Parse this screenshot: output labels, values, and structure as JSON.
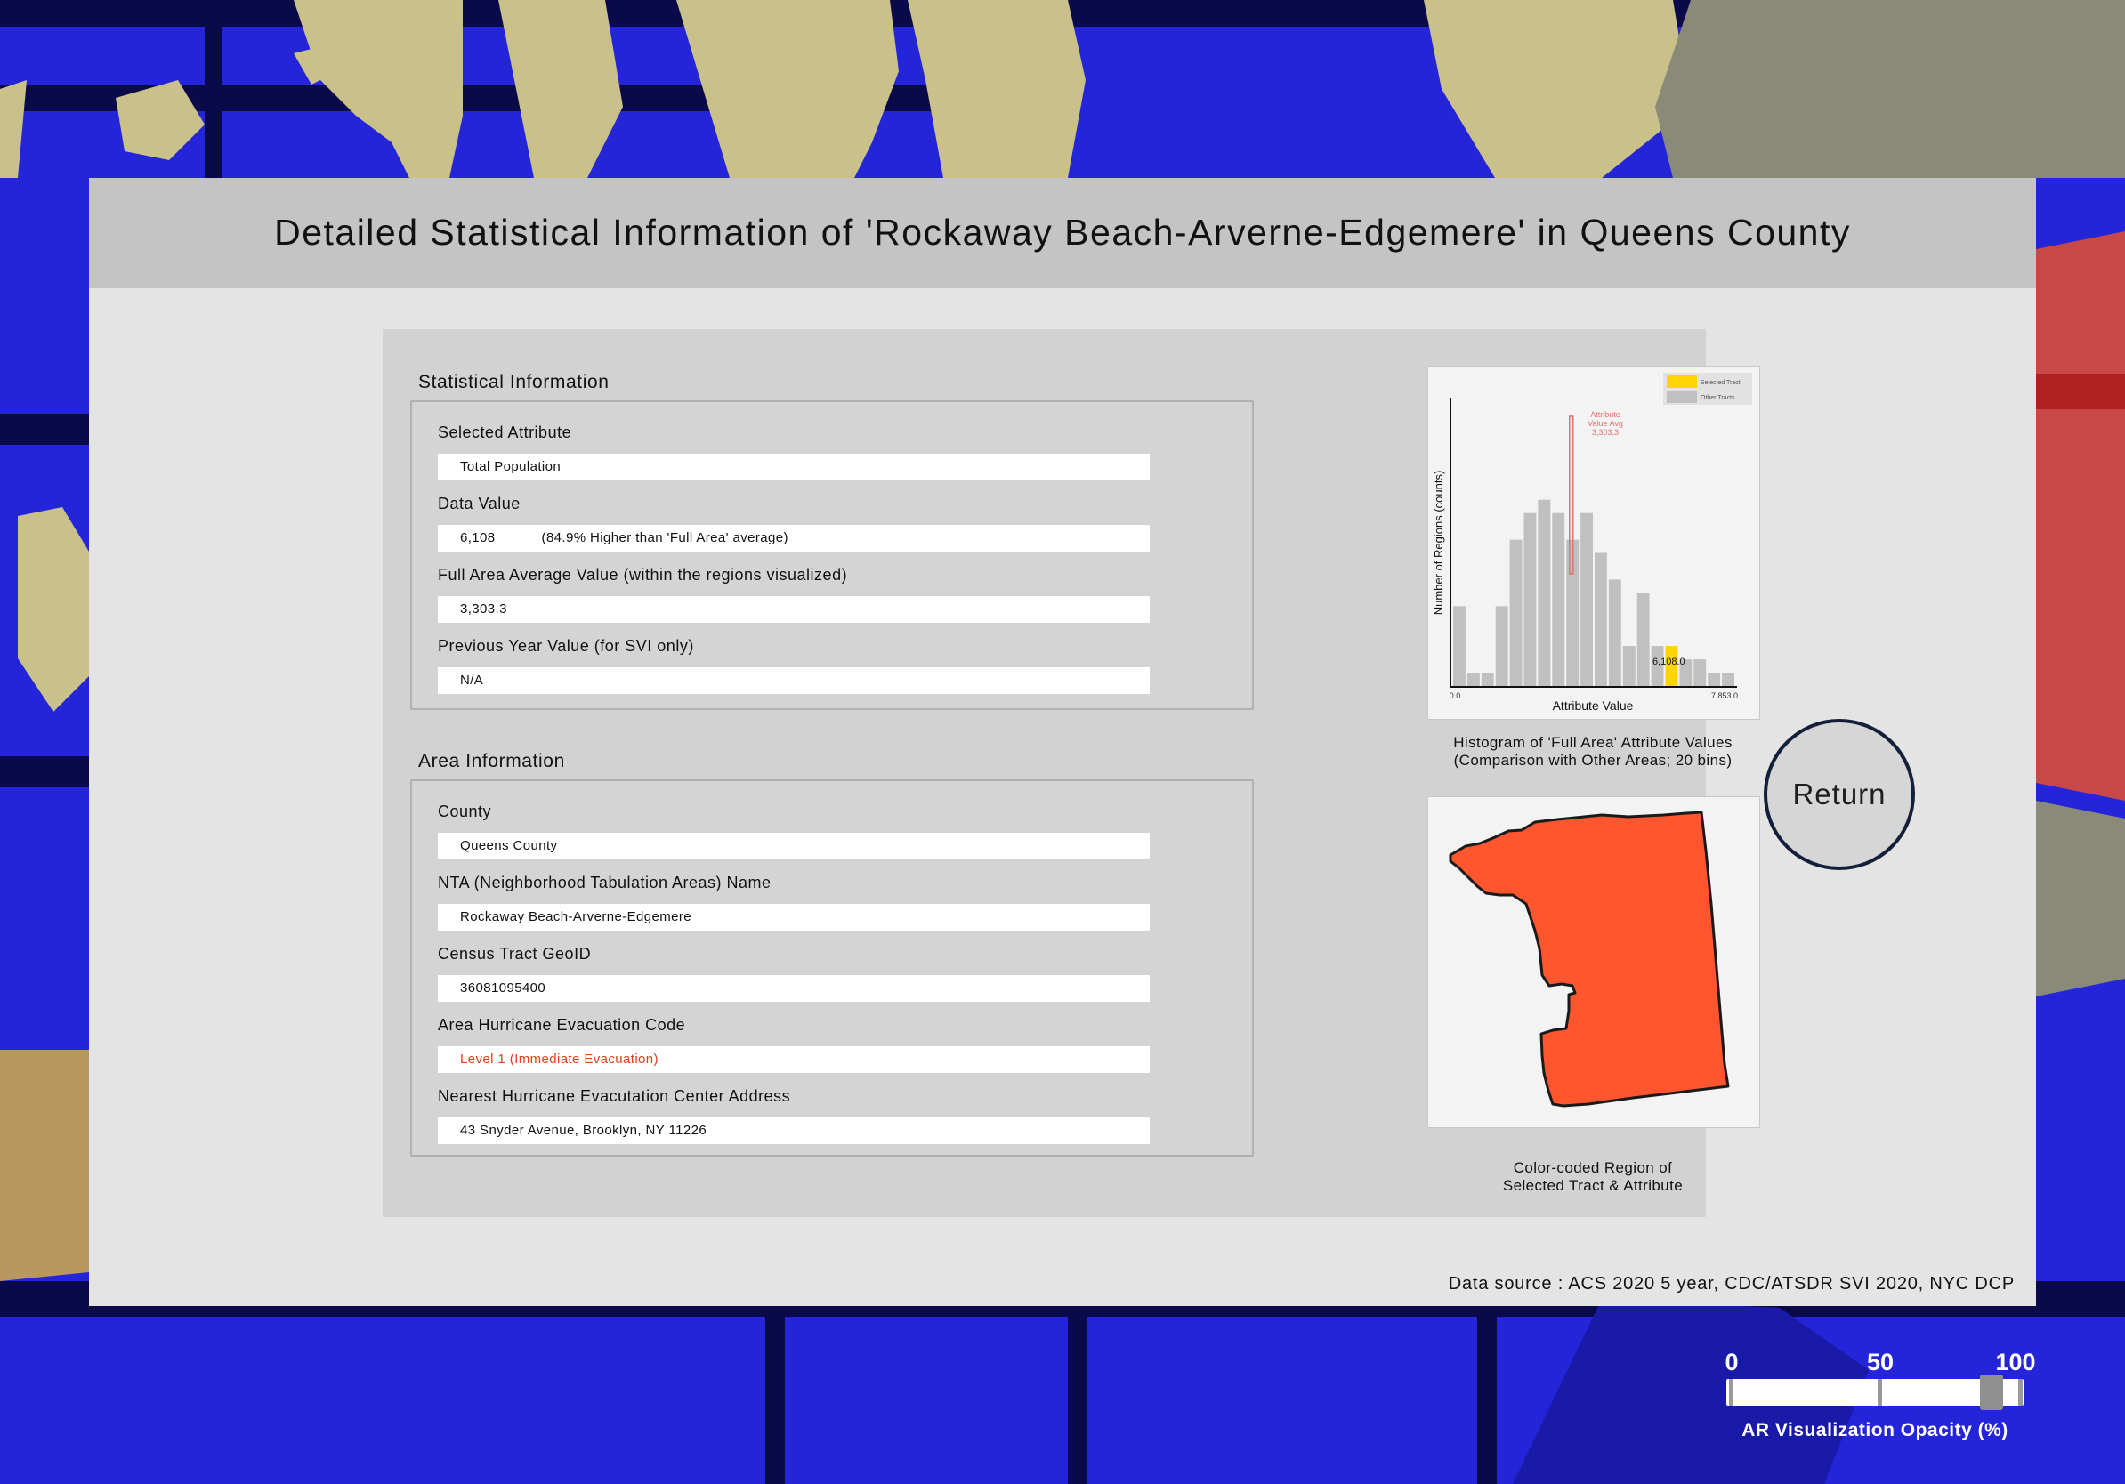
{
  "modal": {
    "title": "Detailed Statistical Information of 'Rockaway Beach-Arverne-Edgemere' in Queens County",
    "data_source": "Data source : ACS 2020 5 year, CDC/ATSDR SVI 2020, NYC DCP"
  },
  "statistical": {
    "section_label": "Statistical Information",
    "selected_attribute_label": "Selected Attribute",
    "selected_attribute_value": "Total Population",
    "data_value_label": "Data Value",
    "data_value": "6,108",
    "data_value_comparison": "(84.9% Higher than 'Full Area' average)",
    "full_area_avg_label": "Full Area Average Value (within the regions visualized)",
    "full_area_avg_value": "3,303.3",
    "previous_year_label": "Previous Year Value (for SVI only)",
    "previous_year_value": "N/A"
  },
  "area": {
    "section_label": "Area Information",
    "county_label": "County",
    "county_value": "Queens County",
    "nta_label": "NTA (Neighborhood Tabulation Areas) Name",
    "nta_value": "Rockaway Beach-Arverne-Edgemere",
    "geoid_label": "Census Tract GeoID",
    "geoid_value": "36081095400",
    "evac_code_label": "Area Hurricane Evacuation Code",
    "evac_code_value": "Level 1 (Immediate Evacuation)",
    "evac_center_label": "Nearest Hurricane Evacutation Center Address",
    "evac_center_value": "43 Snyder Avenue, Brooklyn, NY 11226"
  },
  "histogram": {
    "caption_line1": "Histogram of 'Full Area' Attribute Values",
    "caption_line2": "(Comparison with Other Areas; 20 bins)"
  },
  "region_map": {
    "caption_line1": "Color-coded Region of",
    "caption_line2": "Selected Tract & Attribute",
    "fill_color": "#ff5630"
  },
  "return_button": {
    "label": "Return"
  },
  "opacity_slider": {
    "label": "AR Visualization Opacity (%)",
    "ticks": [
      "0",
      "50",
      "100"
    ],
    "value_percent": 90
  },
  "colors": {
    "selected_tract": "#ffd400",
    "other_tracts": "#c0c0c0",
    "average_line": "#e07070",
    "evacuation_level": "#e0401c"
  },
  "chart_data": {
    "type": "bar",
    "title": "",
    "xlabel": "Attribute Value",
    "ylabel": "Number of Regions (counts)",
    "x_tick_labels": [
      "0.0",
      "7,853.0"
    ],
    "xlim": [
      0,
      7853
    ],
    "bins": 20,
    "series": [
      {
        "name": "Other Tracts",
        "values": [
          6,
          1,
          1,
          6,
          11,
          13,
          14,
          13,
          11,
          13,
          10,
          8,
          3,
          7,
          3,
          1,
          2,
          2,
          1,
          1
        ]
      },
      {
        "name": "Selected Tract",
        "values": [
          0,
          0,
          0,
          0,
          0,
          0,
          0,
          0,
          0,
          0,
          0,
          0,
          0,
          0,
          0,
          3,
          0,
          0,
          0,
          0
        ]
      }
    ],
    "legend": [
      "Selected Tract",
      "Other Tracts"
    ],
    "legend_position": "top-right",
    "annotations": {
      "average_label_lines": [
        "Attribute",
        "Value Avg",
        "3,303.3"
      ],
      "average_value": 3303.3,
      "selected_value_label": "6,108.0",
      "selected_value": 6108.0
    }
  }
}
